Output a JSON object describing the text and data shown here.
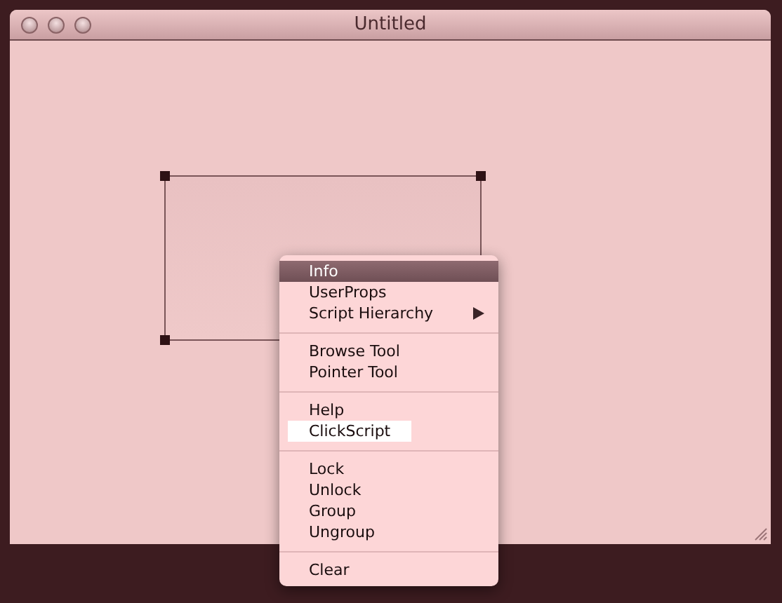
{
  "window": {
    "title": "Untitled"
  },
  "canvas": {
    "objects": [
      {
        "kind": "rectangle",
        "selected": true
      }
    ]
  },
  "context_menu": {
    "groups": [
      [
        {
          "label": "Info",
          "selected": true,
          "marked": false,
          "submenu": false
        },
        {
          "label": "UserProps",
          "selected": false,
          "marked": false,
          "submenu": false
        },
        {
          "label": "Script Hierarchy",
          "selected": false,
          "marked": false,
          "submenu": true
        }
      ],
      [
        {
          "label": "Browse Tool",
          "selected": false,
          "marked": false,
          "submenu": false
        },
        {
          "label": "Pointer Tool",
          "selected": false,
          "marked": false,
          "submenu": false
        }
      ],
      [
        {
          "label": "Help",
          "selected": false,
          "marked": false,
          "submenu": false
        },
        {
          "label": "ClickScript",
          "selected": false,
          "marked": true,
          "submenu": false
        }
      ],
      [
        {
          "label": "Lock",
          "selected": false,
          "marked": false,
          "submenu": false
        },
        {
          "label": "Unlock",
          "selected": false,
          "marked": false,
          "submenu": false
        },
        {
          "label": "Group",
          "selected": false,
          "marked": false,
          "submenu": false
        },
        {
          "label": "Ungroup",
          "selected": false,
          "marked": false,
          "submenu": false
        }
      ],
      [
        {
          "label": "Clear",
          "selected": false,
          "marked": false,
          "submenu": false
        }
      ]
    ]
  }
}
